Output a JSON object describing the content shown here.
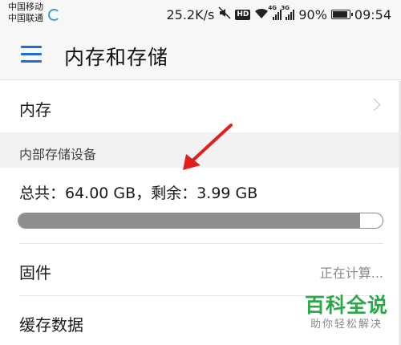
{
  "status_bar": {
    "carrier_1": "中国移动",
    "carrier_2": "中国联通",
    "net_speed": "25.2K/s",
    "hd_label": "HD",
    "signal_1_label": "4G",
    "signal_2_label": "3G",
    "battery_percent": "90%",
    "battery_level": 0.9,
    "time": "09:54",
    "icons": [
      "mute-icon",
      "hd-icon",
      "wifi-icon",
      "signal-icon",
      "signal-icon",
      "battery-icon"
    ]
  },
  "toolbar": {
    "title": "内存和存储",
    "menu_icon": "menu-icon",
    "accent_color": "#1f6fd0"
  },
  "memory_row": {
    "label": "内存",
    "chevron_icon": "chevron-right-icon"
  },
  "internal_storage": {
    "section_title": "内部存储设备",
    "summary": "总共：64.00 GB，剩余：3.99 GB",
    "used_fraction": 0.938
  },
  "firmware_row": {
    "label": "固件",
    "value": "正在计算..."
  },
  "cache_row": {
    "label": "缓存数据"
  },
  "annotation": {
    "arrow_color": "#e02020"
  },
  "watermark": {
    "title": "百科全说",
    "subtitle": "助你轻松解决",
    "color": "#2aa84a"
  }
}
